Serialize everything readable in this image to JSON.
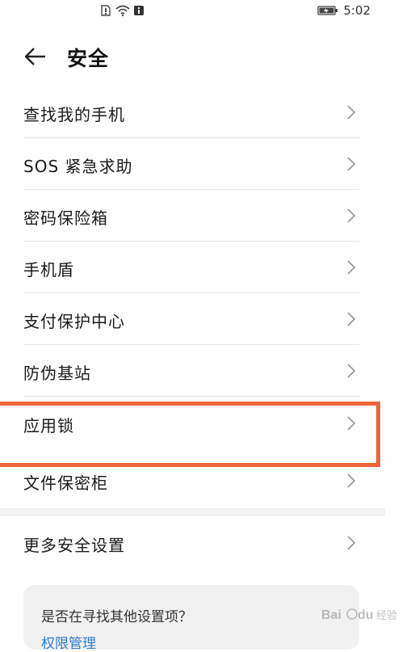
{
  "status_bar": {
    "time": "5:02",
    "icons": [
      "sim-icon",
      "wifi-icon",
      "notification-icon",
      "battery-charging-icon"
    ]
  },
  "header": {
    "back_icon": "back-arrow-icon",
    "title": "安全"
  },
  "list": {
    "items": [
      {
        "label": "查找我的手机"
      },
      {
        "label": "SOS 紧急求助"
      },
      {
        "label": "密码保险箱"
      },
      {
        "label": "手机盾"
      },
      {
        "label": "支付保护中心"
      },
      {
        "label": "防伪基站"
      },
      {
        "label": "应用锁"
      },
      {
        "label": "文件保密柜"
      }
    ]
  },
  "more": {
    "label": "更多安全设置"
  },
  "suggestion": {
    "text": "是否在寻找其他设置项？",
    "link": "权限管理"
  },
  "watermark": {
    "text": "Baidu 经验"
  },
  "colors": {
    "highlight": "#f0643a",
    "link": "#2d7bd6",
    "card_bg": "#f1f1f1"
  }
}
